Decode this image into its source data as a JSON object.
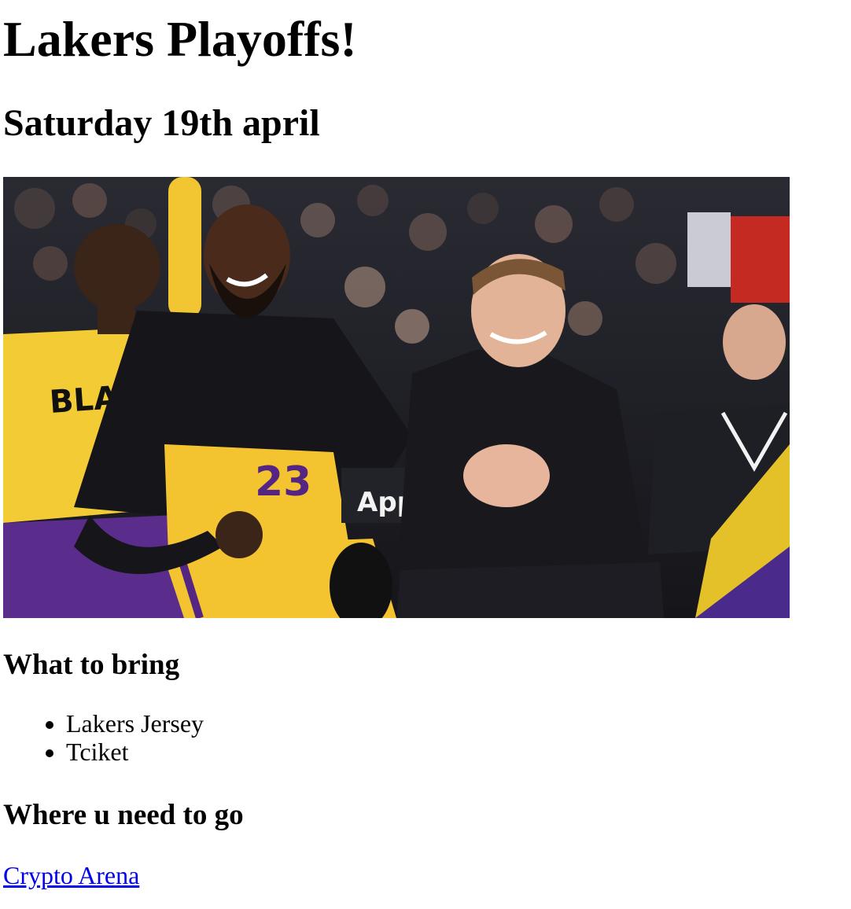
{
  "page": {
    "title": "Lakers Playoffs!",
    "date": "Saturday 19th april"
  },
  "photo": {
    "alt": "Lakers players smiling on the bench",
    "jersey_text": "BLACK HISTORY",
    "ad_text": "App"
  },
  "bring": {
    "heading": "What to bring",
    "items": [
      "Lakers Jersey",
      "Tciket"
    ]
  },
  "where": {
    "heading": "Where u need to go",
    "link_text": "Crypto Arena"
  },
  "colors": {
    "link": "#0000ee",
    "lakers_gold": "#f4c430",
    "lakers_purple": "#552583"
  }
}
